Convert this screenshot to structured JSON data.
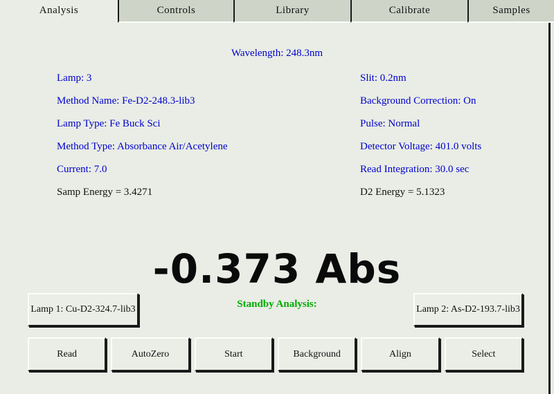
{
  "colors": {
    "background": "#e9ede5",
    "tab_unselected": "#ced4c8",
    "param_blue": "#0000cc",
    "status_green": "#00aa00",
    "text_black": "#111111"
  },
  "tabs": [
    {
      "label": "Analysis",
      "selected": true
    },
    {
      "label": "Controls",
      "selected": false
    },
    {
      "label": "Library",
      "selected": false
    },
    {
      "label": "Calibrate",
      "selected": false
    },
    {
      "label": "Samples",
      "selected": false
    }
  ],
  "analysis": {
    "wavelength": "Wavelength: 248.3nm",
    "left_params": [
      "Lamp: 3",
      "Method Name: Fe-D2-248.3-lib3",
      "Lamp Type: Fe Buck Sci",
      "Method Type: Absorbance Air/Acetylene",
      "Current: 7.0"
    ],
    "left_energy": "Samp Energy = 3.4271",
    "right_params": [
      "Slit: 0.2nm",
      "Background Correction: On",
      "Pulse: Normal",
      "Detector Voltage: 401.0 volts",
      "Read Integration: 30.0 sec"
    ],
    "right_energy": "D2 Energy = 5.1323",
    "reading": "-0.373 Abs",
    "status": "Standby Analysis:",
    "lamp1_button": "Lamp 1: Cu-D2-324.7-lib3",
    "lamp2_button": "Lamp 2: As-D2-193.7-lib3",
    "action_buttons": [
      "Read",
      "AutoZero",
      "Start",
      "Background",
      "Align",
      "Select"
    ]
  }
}
